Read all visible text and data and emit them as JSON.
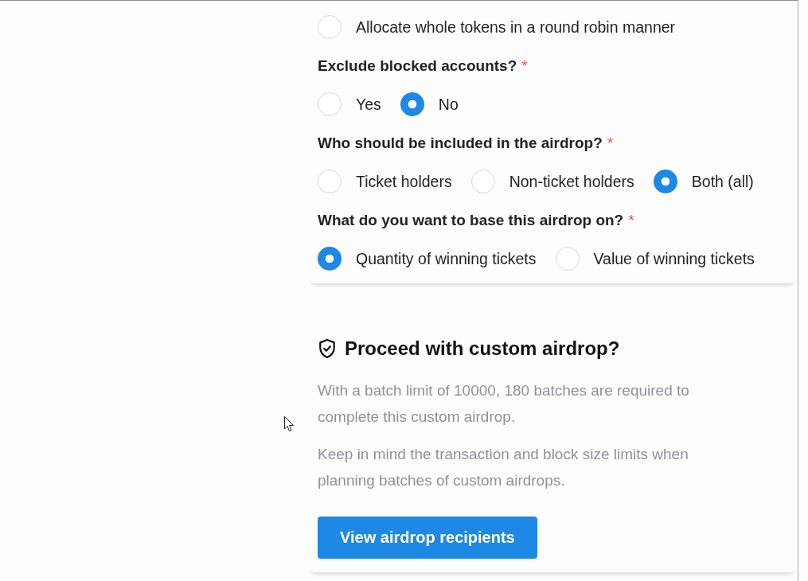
{
  "option_groups": [
    {
      "options": [
        {
          "label": "Allocate whole tokens in a round robin manner",
          "selected": false
        }
      ]
    },
    {
      "question": "Exclude blocked accounts?",
      "required_mark": "*",
      "options": [
        {
          "label": "Yes",
          "selected": false
        },
        {
          "label": "No",
          "selected": true
        }
      ]
    },
    {
      "question": "Who should be included in the airdrop?",
      "required_mark": "*",
      "options": [
        {
          "label": "Ticket holders",
          "selected": false
        },
        {
          "label": "Non-ticket holders",
          "selected": false
        },
        {
          "label": "Both (all)",
          "selected": true
        }
      ]
    },
    {
      "question": "What do you want to base this airdrop on?",
      "required_mark": "*",
      "options": [
        {
          "label": "Quantity of winning tickets",
          "selected": true
        },
        {
          "label": "Value of winning tickets",
          "selected": false
        }
      ]
    }
  ],
  "custom_airdrop": {
    "title": "Proceed with custom airdrop?",
    "paragraphs": [
      "With a batch limit of 10000, 180 batches are required to complete this custom airdrop.",
      "Keep in mind the transaction and block size limits when planning batches of custom airdrops."
    ],
    "button": "View airdrop recipients"
  }
}
